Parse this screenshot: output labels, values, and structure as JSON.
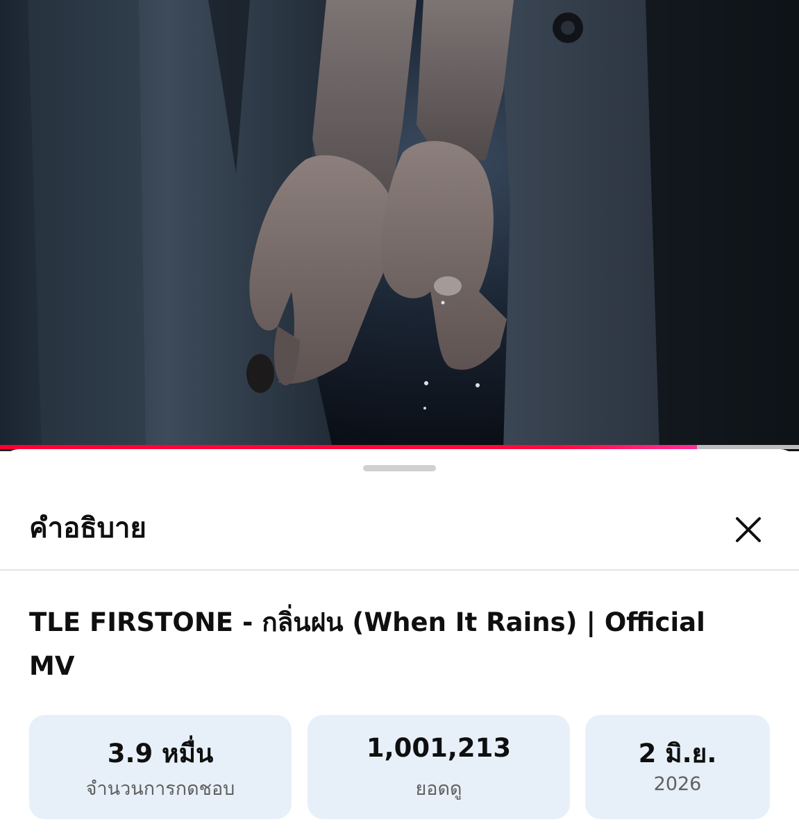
{
  "video": {
    "progress_fraction": 0.872,
    "thumbnail_description_icon": "video-frame"
  },
  "sheet": {
    "title": "คำอธิบาย",
    "close_icon": "close-icon"
  },
  "video_title": "TLE FIRSTONE - กลิ่นฝน (When It Rains) | Official MV",
  "stats": [
    {
      "value": "3.9 หมื่น",
      "label": "จำนวนการกดชอบ"
    },
    {
      "value": "1,001,213",
      "label": "ยอดดู"
    },
    {
      "value": "2 มิ.ย.",
      "label": "2026"
    }
  ],
  "colors": {
    "accent_red": "#ff0033",
    "card_bg": "#e7f0f8",
    "secondary_text": "#606060"
  }
}
